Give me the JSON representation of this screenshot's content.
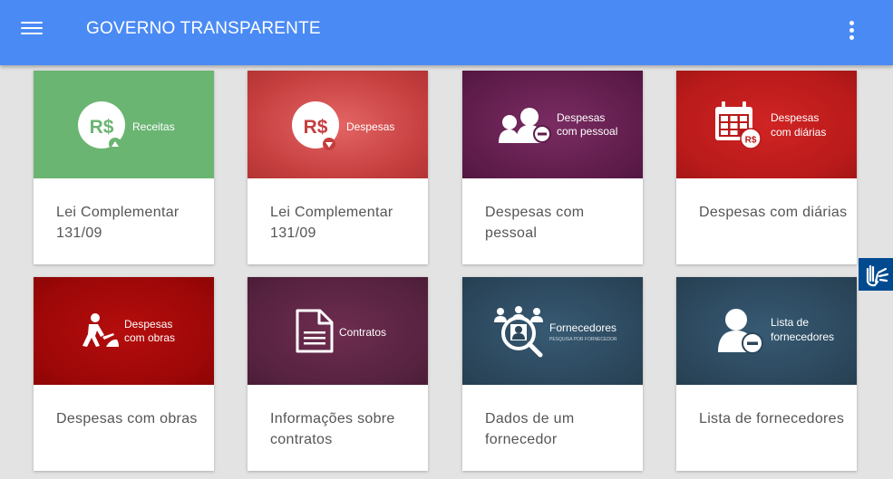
{
  "header": {
    "title": "GOVERNO TRANSPARENTE",
    "menu_icon": "hamburger-menu-icon",
    "more_icon": "more-vert-icon",
    "color": "#4a8af4"
  },
  "cards": [
    {
      "banner_label": "Receitas",
      "icon": "money-income-icon",
      "title": "Lei Complementar 131/09",
      "color": "#6bb573"
    },
    {
      "banner_label": "Despesas",
      "icon": "money-expense-icon",
      "title": "Lei Complementar 131/09",
      "color": "#c94444"
    },
    {
      "banner_label_line1": "Despesas",
      "banner_label_line2": "com pessoal",
      "icon": "people-minus-icon",
      "title": "Despesas com pessoal",
      "color": "#5e1c4a"
    },
    {
      "banner_label_line1": "Despesas",
      "banner_label_line2": "com diárias",
      "icon": "calendar-money-icon",
      "title": "Despesas com diárias",
      "color": "#b81a1a"
    },
    {
      "banner_label_line1": "Despesas",
      "banner_label_line2": "com obras",
      "icon": "construction-worker-icon",
      "title": "Despesas com obras",
      "color": "#9c0707"
    },
    {
      "banner_label": "Contratos",
      "icon": "document-icon",
      "title": "Informações sobre contratos",
      "color": "#56223f"
    },
    {
      "banner_label": "Fornecedores",
      "banner_sublabel": "PESQUISA POR FORNECEDOR",
      "icon": "supplier-search-icon",
      "title": "Dados de um fornecedor",
      "color": "#2b465b"
    },
    {
      "banner_label_line1": "Lista de",
      "banner_label_line2": "fornecedores",
      "icon": "person-minus-icon",
      "title": "Lista de fornecedores",
      "color": "#2b465b"
    }
  ],
  "accessibility_button": {
    "icon": "sign-language-icon",
    "color": "#004a90"
  }
}
